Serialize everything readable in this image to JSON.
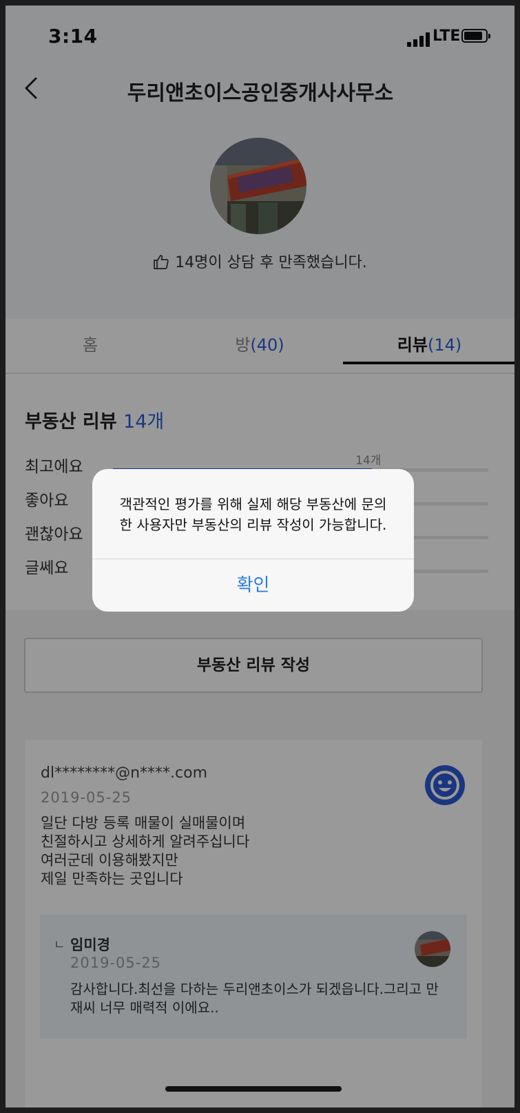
{
  "status_bar": {
    "time": "3:14",
    "network": "LTE"
  },
  "header": {
    "title": "두리앤초이스공인중개사사무소",
    "satisfaction": "14명이 상담 후 만족했습니다."
  },
  "tabs": [
    {
      "label": "홈",
      "count": ""
    },
    {
      "label": "방",
      "count": "(40)"
    },
    {
      "label": "리뷰",
      "count": "(14)"
    }
  ],
  "review_summary": {
    "title": "부동산 리뷰",
    "count": "14개",
    "ratings": [
      {
        "label": "최고에요",
        "count_label": "14개",
        "fraction": 0.69
      },
      {
        "label": "좋아요",
        "count_label": "",
        "fraction": 0
      },
      {
        "label": "괜찮아요",
        "count_label": "",
        "fraction": 0
      },
      {
        "label": "글쎄요",
        "count_label": "",
        "fraction": 0
      }
    ]
  },
  "write_button": "부동산 리뷰 작성",
  "review": {
    "email": "dl********@n****.com",
    "date": "2019-05-25",
    "lines": [
      "일단 다방 등록 매물이 실매물이며",
      "친절하시고 상세하게 알려주십니다",
      "여러군데 이용해봤지만",
      "제일 만족하는 곳입니다"
    ],
    "reply": {
      "corner": "ㄴ",
      "name": "임미경",
      "date": "2019-05-25",
      "text": "감사합니다.최선을 다하는 두리앤초이스가 되겠읍니다.그리고 만재씨 너무 매력적 이에요.."
    }
  },
  "dialog": {
    "message_line1": "객관적인 평가를 위해 실제 해당 부동산에 문의",
    "message_line2": "한 사용자만 부동산의 리뷰 작성이 가능합니다.",
    "confirm": "확인"
  },
  "colors": {
    "accent": "#2c5bd6",
    "dialog_button": "#2a7ee0"
  }
}
